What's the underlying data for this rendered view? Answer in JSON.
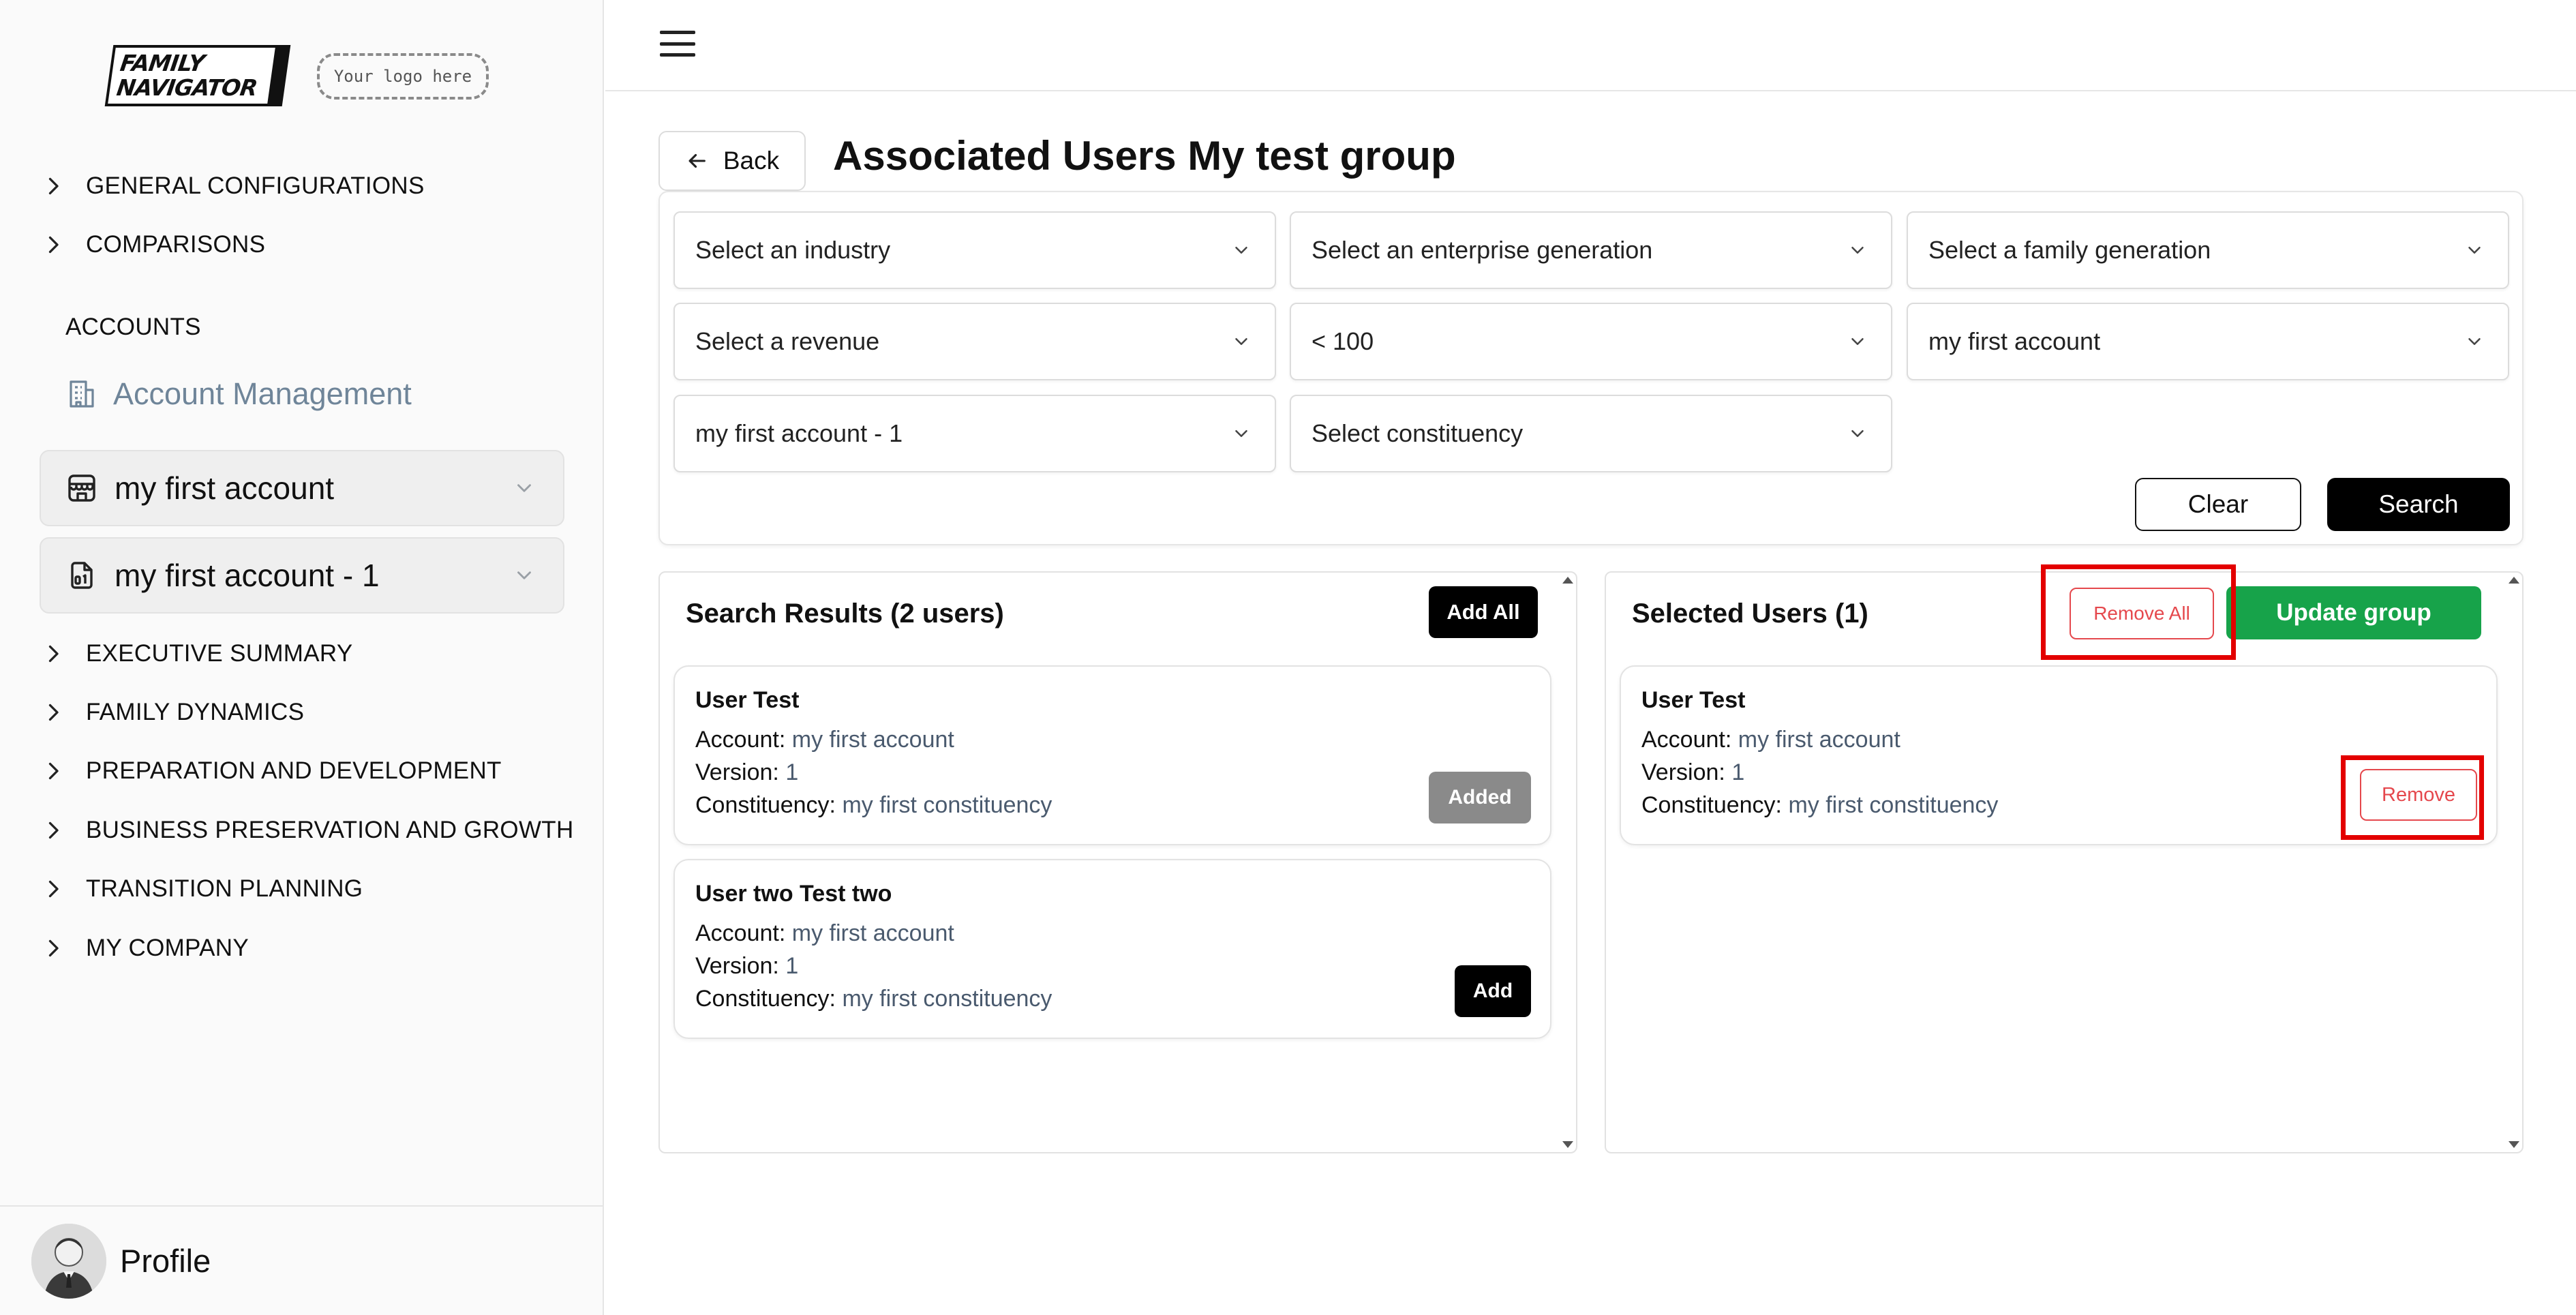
{
  "sidebar": {
    "logo_line1": "FAMILY",
    "logo_line2": "NAVIGATOR",
    "your_logo": "Your logo here",
    "nav_top": [
      {
        "label": "GENERAL CONFIGURATIONS"
      },
      {
        "label": "COMPARISONS"
      }
    ],
    "accounts_heading": "ACCOUNTS",
    "account_management": "Account Management",
    "account_selectors": [
      {
        "label": "my first account"
      },
      {
        "label": "my first account - 1"
      }
    ],
    "nav_bottom": [
      {
        "label": "EXECUTIVE SUMMARY"
      },
      {
        "label": "FAMILY DYNAMICS"
      },
      {
        "label": "PREPARATION AND DEVELOPMENT"
      },
      {
        "label": "BUSINESS PRESERVATION AND GROWTH"
      },
      {
        "label": "TRANSITION PLANNING"
      },
      {
        "label": "MY COMPANY"
      }
    ],
    "profile_label": "Profile"
  },
  "header": {
    "back_label": "Back",
    "title": "Associated Users My test group"
  },
  "filters": {
    "selects": [
      {
        "label": "Select an industry"
      },
      {
        "label": "Select an enterprise generation"
      },
      {
        "label": "Select a family generation"
      },
      {
        "label": "Select a revenue"
      },
      {
        "label": "< 100"
      },
      {
        "label": "my first account"
      },
      {
        "label": "my first account - 1"
      },
      {
        "label": "Select constituency"
      }
    ],
    "clear_label": "Clear",
    "search_label": "Search"
  },
  "search_results": {
    "title": "Search Results (2 users)",
    "add_all_label": "Add All",
    "users": [
      {
        "name": "User Test",
        "account_label": "Account:",
        "account": "my first account",
        "version_label": "Version:",
        "version": "1",
        "constituency_label": "Constituency:",
        "constituency": "my first constituency",
        "action": "Added"
      },
      {
        "name": "User two Test two",
        "account_label": "Account:",
        "account": "my first account",
        "version_label": "Version:",
        "version": "1",
        "constituency_label": "Constituency:",
        "constituency": "my first constituency",
        "action": "Add"
      }
    ]
  },
  "selected_users": {
    "title": "Selected Users (1)",
    "remove_all_label": "Remove All",
    "update_label": "Update group",
    "users": [
      {
        "name": "User Test",
        "account_label": "Account:",
        "account": "my first account",
        "version_label": "Version:",
        "version": "1",
        "constituency_label": "Constituency:",
        "constituency": "my first constituency",
        "action": "Remove"
      }
    ]
  },
  "colors": {
    "accent_green": "#17a34a",
    "danger_red": "#e5484d",
    "highlight_red": "#e30000",
    "muted_blue": "#6f8599"
  }
}
